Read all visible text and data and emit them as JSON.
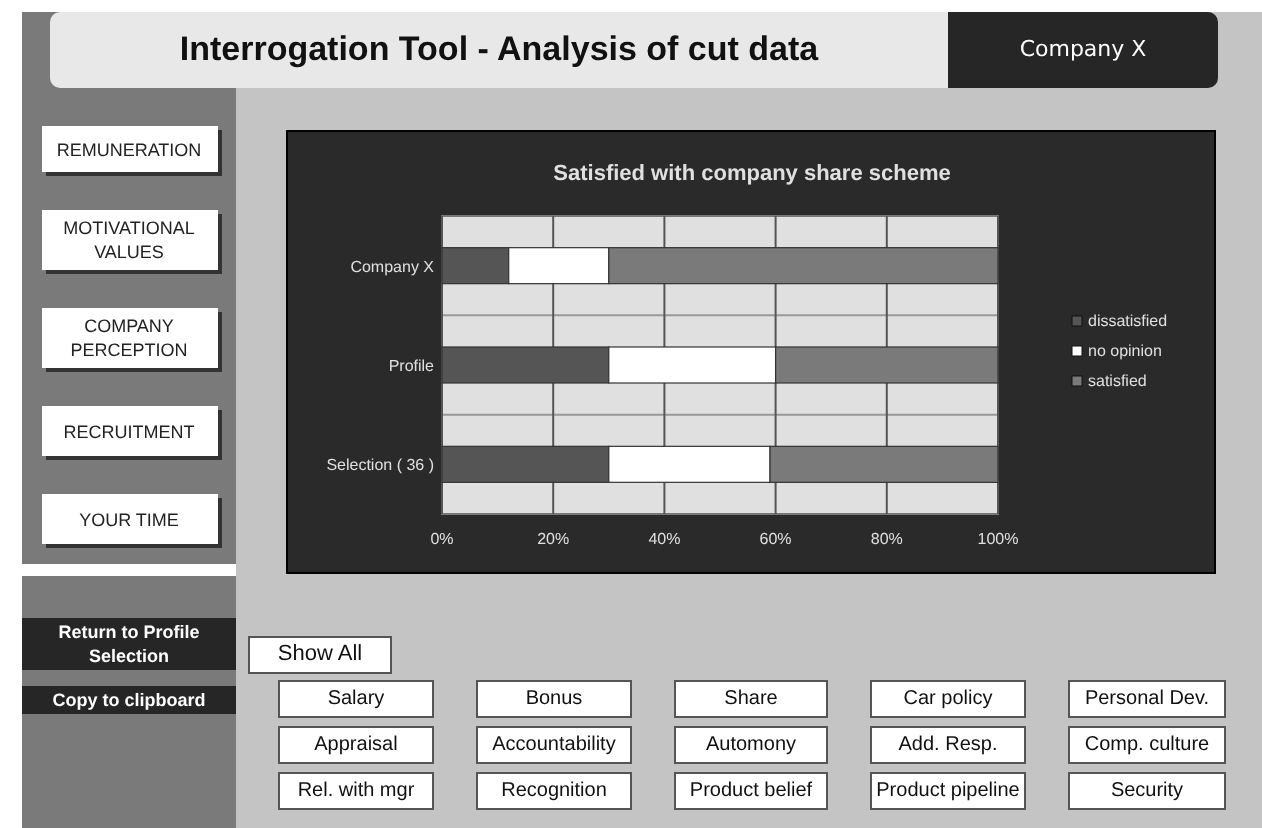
{
  "header": {
    "title": "Interrogation Tool - Analysis of cut data",
    "company": "Company X"
  },
  "sidebar": {
    "items": [
      {
        "label": "REMUNERATION"
      },
      {
        "label": "MOTIVATIONAL VALUES"
      },
      {
        "label": "COMPANY PERCEPTION"
      },
      {
        "label": "RECRUITMENT"
      },
      {
        "label": "YOUR TIME"
      }
    ],
    "actions": [
      {
        "label": "Return to Profile Selection"
      },
      {
        "label": "Copy  to clipboard"
      }
    ]
  },
  "chart": {
    "chart_data": {
      "type": "bar",
      "orientation": "horizontal",
      "stacked": true,
      "grid": true,
      "legend": true,
      "title": "Satisfied with company share scheme",
      "categories": [
        "Company X",
        "Profile",
        "Selection ( 36 )"
      ],
      "series": [
        {
          "name": "dissatisfied",
          "color": "#555555",
          "values": [
            12,
            30,
            30
          ]
        },
        {
          "name": "no opinion",
          "color": "#ffffff",
          "values": [
            18,
            30,
            29
          ]
        },
        {
          "name": "satisfied",
          "color": "#7a7a7a",
          "values": [
            70,
            40,
            41
          ]
        }
      ],
      "xlim": [
        0,
        100
      ],
      "xticks": [
        {
          "value": 0,
          "label": "0%"
        },
        {
          "value": 20,
          "label": "20%"
        },
        {
          "value": 40,
          "label": "40%"
        },
        {
          "value": 60,
          "label": "60%"
        },
        {
          "value": 80,
          "label": "80%"
        },
        {
          "value": 100,
          "label": "100%"
        }
      ]
    }
  },
  "show_all": {
    "label": "Show All"
  },
  "filters": [
    [
      "Salary",
      "Bonus",
      "Share",
      "Car policy",
      "Personal Dev."
    ],
    [
      "Appraisal",
      "Accountability",
      "Automony",
      "Add. Resp.",
      "Comp. culture"
    ],
    [
      "Rel. with mgr",
      "Recognition",
      "Product belief",
      "Product pipeline",
      "Security"
    ]
  ]
}
